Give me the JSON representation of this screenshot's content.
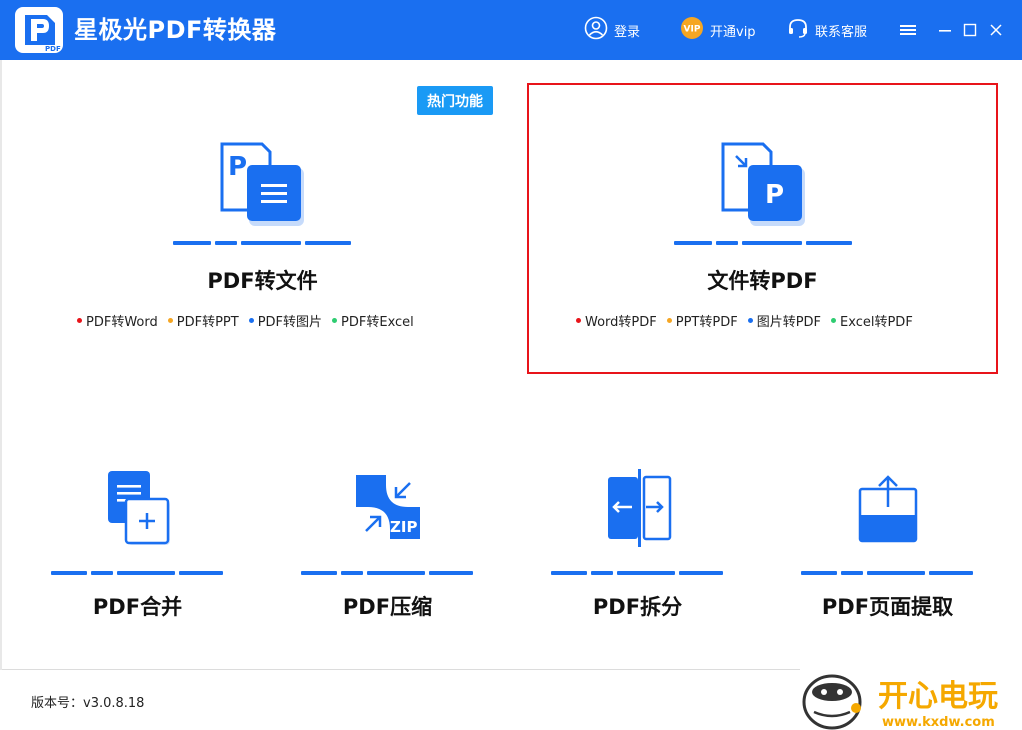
{
  "app": {
    "title": "星极光PDF转换器",
    "logo_text": "PDF"
  },
  "toolbar": {
    "login_label": "登录",
    "vip_badge": "VIP",
    "vip_label": "开通vip",
    "service_label": "联系客服"
  },
  "hot_badge": "热门功能",
  "cards": {
    "pdf_to_file": {
      "title": "PDF转文件",
      "items": [
        "PDF转Word",
        "PDF转PPT",
        "PDF转图片",
        "PDF转Excel"
      ]
    },
    "file_to_pdf": {
      "title": "文件转PDF",
      "items": [
        "Word转PDF",
        "PPT转PDF",
        "图片转PDF",
        "Excel转PDF"
      ]
    }
  },
  "tools": {
    "merge": "PDF合并",
    "compress": "PDF压缩",
    "compress_icon_text": "ZIP",
    "split": "PDF拆分",
    "extract": "PDF页面提取"
  },
  "footer": {
    "version": "版本号：v3.0.8.18"
  },
  "watermark": {
    "text": "开心电玩",
    "url": "www.kxdw.com"
  },
  "colors": {
    "titlebar": "#1a6ff0",
    "accent": "#1a6ff0",
    "selection_border": "#e8141a",
    "dot_red": "#e8141a",
    "dot_orange": "#f5a623",
    "dot_blue": "#1a6ff0",
    "dot_green": "#2ecc71",
    "watermark": "#f5a800"
  }
}
